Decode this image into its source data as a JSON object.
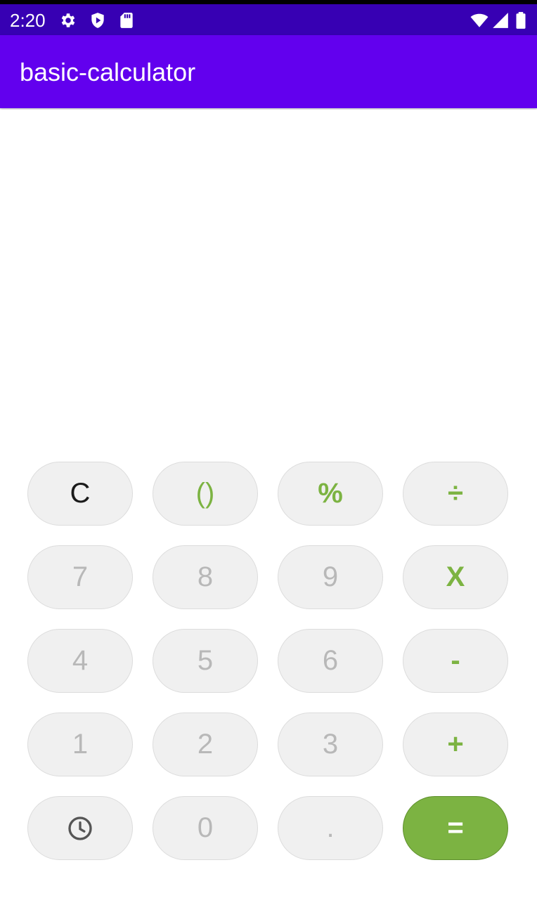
{
  "status_bar": {
    "time": "2:20",
    "left_icons": [
      "gear-icon",
      "shield-icon",
      "sd-card-icon"
    ],
    "right_icons": [
      "wifi-icon",
      "signal-icon",
      "battery-icon"
    ],
    "color": "#3700b3"
  },
  "app_bar": {
    "title": "basic-calculator",
    "color": "#6200ee"
  },
  "display": {
    "expression": "",
    "result": ""
  },
  "keypad": {
    "rows": [
      [
        "C",
        "()",
        "%",
        "÷"
      ],
      [
        "7",
        "8",
        "9",
        "X"
      ],
      [
        "4",
        "5",
        "6",
        "-"
      ],
      [
        "1",
        "2",
        "3",
        "+"
      ],
      [
        "history-icon",
        "0",
        ".",
        "="
      ]
    ],
    "operator_color": "#7cb342",
    "digit_color": "#b8b8b8",
    "equals_background": "#7cb342"
  }
}
